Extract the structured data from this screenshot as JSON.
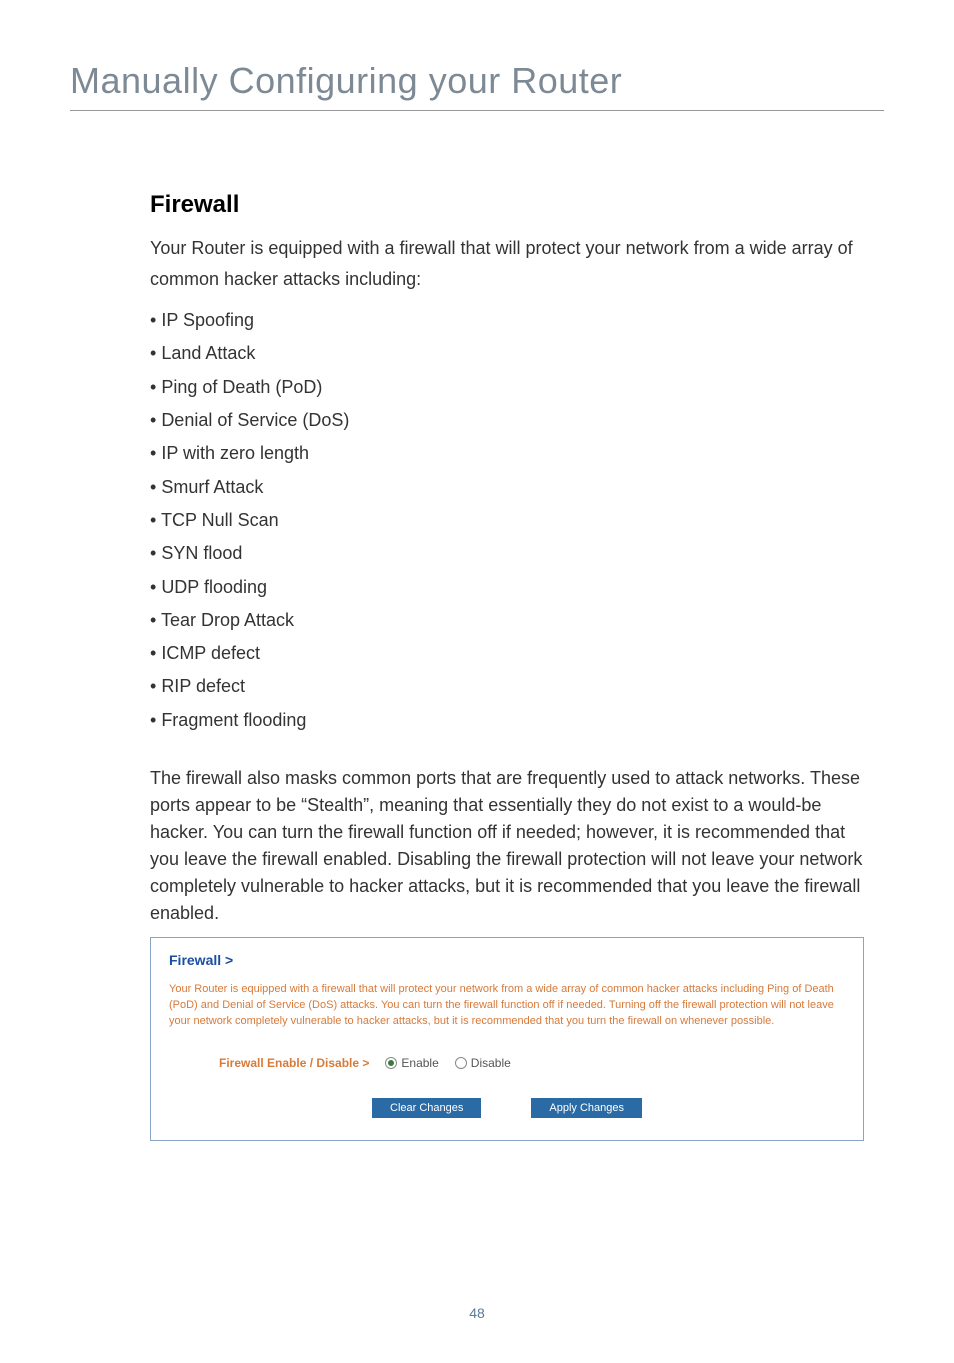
{
  "page": {
    "title": "Manually Configuring your Router",
    "number": "48"
  },
  "section": {
    "heading": "Firewall",
    "intro": "Your Router is equipped with a firewall that will protect your network from a wide array of common hacker attacks including:",
    "bullets": [
      "IP Spoofing",
      "Land Attack",
      "Ping of Death (PoD)",
      "Denial of Service (DoS)",
      "IP with zero length",
      "Smurf Attack",
      "TCP Null Scan",
      "SYN flood",
      "UDP flooding",
      "Tear Drop Attack",
      "ICMP defect",
      "RIP defect",
      "Fragment flooding"
    ],
    "paragraph": "The firewall also masks common ports that are frequently used to attack networks. These ports appear to be “Stealth”, meaning that essentially they do not exist to a would-be hacker. You can turn the firewall function off if needed; however, it is recommended that you leave the firewall enabled. Disabling the firewall protection will not leave your network completely vulnerable to hacker attacks, but it is recommended that you leave the firewall enabled."
  },
  "panel": {
    "title": "Firewall >",
    "description": "Your Router is equipped with a firewall that will protect your network from a wide array of common hacker attacks including Ping of Death (PoD) and Denial of Service (DoS) attacks. You can turn the firewall function off if needed. Turning off the firewall protection will not leave your network completely vulnerable to hacker attacks, but it is recommended that you turn the firewall on whenever possible.",
    "radio_label": "Firewall Enable / Disable >",
    "enable_label": "Enable",
    "disable_label": "Disable",
    "clear_button": "Clear Changes",
    "apply_button": "Apply Changes"
  }
}
